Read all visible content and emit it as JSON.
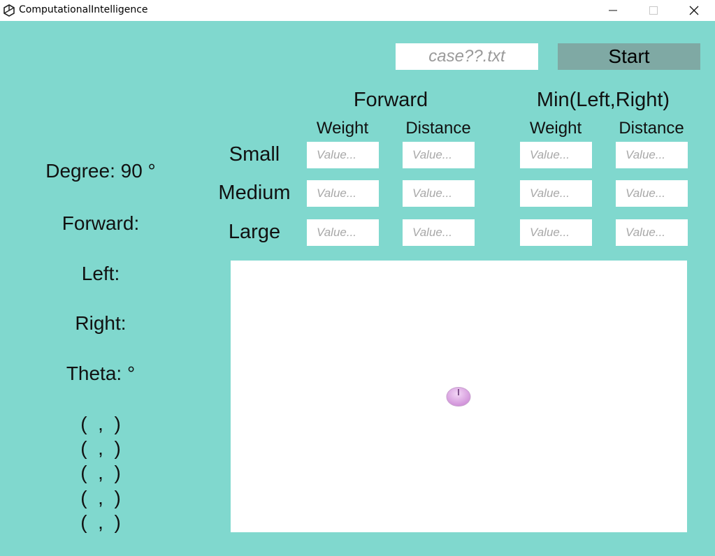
{
  "window": {
    "title": "ComputationalIntelligence",
    "app_icon": "unity-icon",
    "controls": [
      "minimize-icon",
      "maximize-icon",
      "close-icon"
    ]
  },
  "toolbar": {
    "file_placeholder": "case??.txt",
    "file_value": "",
    "start_label": "Start"
  },
  "table": {
    "groups": [
      "Forward",
      "Min(Left,Right)"
    ],
    "columns": [
      "Weight",
      "Distance",
      "Weight",
      "Distance"
    ],
    "rows": [
      "Small",
      "Medium",
      "Large"
    ],
    "input_placeholder": "Value..."
  },
  "info": {
    "degree": "Degree: 90 °",
    "forward": "Forward:",
    "left": "Left:",
    "right": "Right:",
    "theta": "Theta:  °",
    "coords": [
      "(  ,  )",
      "(  ,  )",
      "(  ,  )",
      "(  ,  )",
      "(  ,  )"
    ]
  },
  "colors": {
    "background": "#80d8ce",
    "start_button": "#7fa9a4",
    "car": "#e8b6ee"
  }
}
